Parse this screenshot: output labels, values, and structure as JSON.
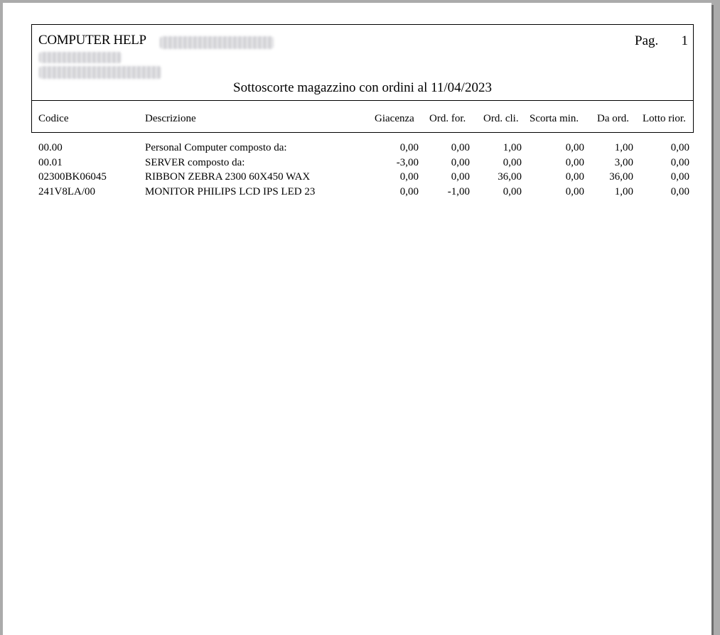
{
  "header": {
    "company": "COMPUTER HELP",
    "page_label": "Pag.",
    "page_number": "1",
    "title": "Sottoscorte magazzino con ordini al 11/04/2023"
  },
  "columns": {
    "codice": "Codice",
    "descrizione": "Descrizione",
    "giacenza": "Giacenza",
    "ord_for": "Ord. for.",
    "ord_cli": "Ord. cli.",
    "scorta_min": "Scorta min.",
    "da_ord": "Da ord.",
    "lotto_rior": "Lotto rior."
  },
  "rows": [
    {
      "codice": "00.00",
      "descrizione": "Personal Computer composto da:",
      "giacenza": "0,00",
      "ord_for": "0,00",
      "ord_cli": "1,00",
      "scorta_min": "0,00",
      "da_ord": "1,00",
      "lotto_rior": "0,00"
    },
    {
      "codice": "00.01",
      "descrizione": "SERVER composto da:",
      "giacenza": "-3,00",
      "ord_for": "0,00",
      "ord_cli": "0,00",
      "scorta_min": "0,00",
      "da_ord": "3,00",
      "lotto_rior": "0,00"
    },
    {
      "codice": "02300BK06045",
      "descrizione": "RIBBON ZEBRA 2300 60X450 WAX",
      "giacenza": "0,00",
      "ord_for": "0,00",
      "ord_cli": "36,00",
      "scorta_min": "0,00",
      "da_ord": "36,00",
      "lotto_rior": "0,00"
    },
    {
      "codice": "241V8LA/00",
      "descrizione": "MONITOR PHILIPS LCD IPS LED 23",
      "giacenza": "0,00",
      "ord_for": "-1,00",
      "ord_cli": "0,00",
      "scorta_min": "0,00",
      "da_ord": "1,00",
      "lotto_rior": "0,00"
    }
  ]
}
